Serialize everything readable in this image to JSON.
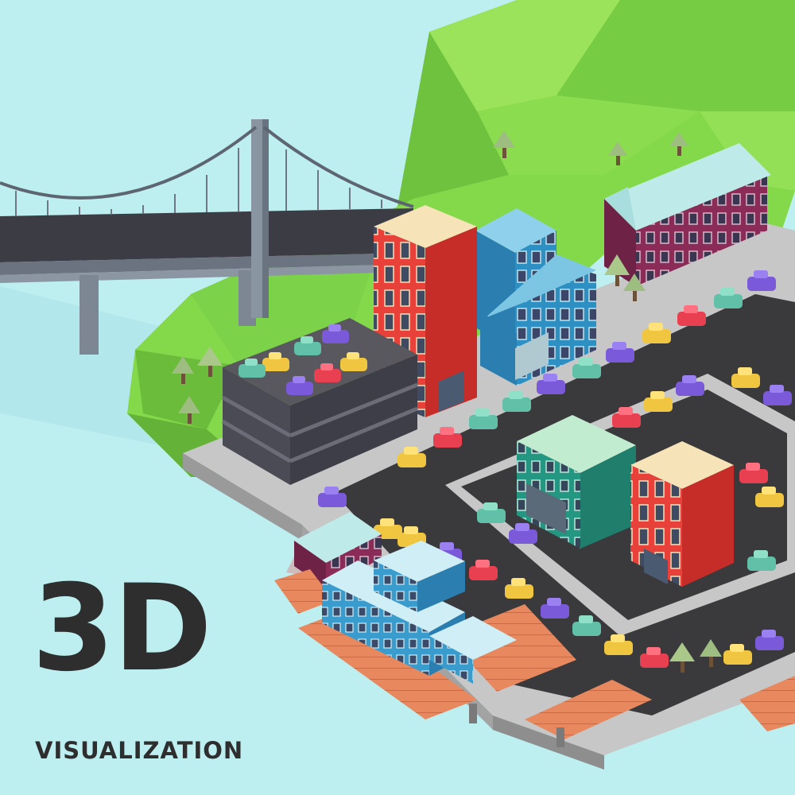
{
  "headline": {
    "title": "3D",
    "subtitle": "VISUALIZATION"
  },
  "scene": {
    "subject": "isometric low-poly city block",
    "objects": [
      "suspension-bridge",
      "green-hill",
      "multi-storey-car-park",
      "red-tower",
      "blue-office",
      "purple-house",
      "teal-office",
      "red-tower-small",
      "wooden-pier",
      "blue-warehouse",
      "parking-lot",
      "parked-cars",
      "trees"
    ]
  },
  "colors": {
    "water": "#bdeef0",
    "grass": "#84d94a",
    "asphalt": "#3a3a3c",
    "sidewalk": "#c7c7c7",
    "brick_red": "#e83a32",
    "office_blue": "#2d8fc0",
    "house_purple": "#8b2c58",
    "office_teal": "#239781",
    "pier_wood": "#e8885e",
    "text": "#2e2e2e"
  }
}
